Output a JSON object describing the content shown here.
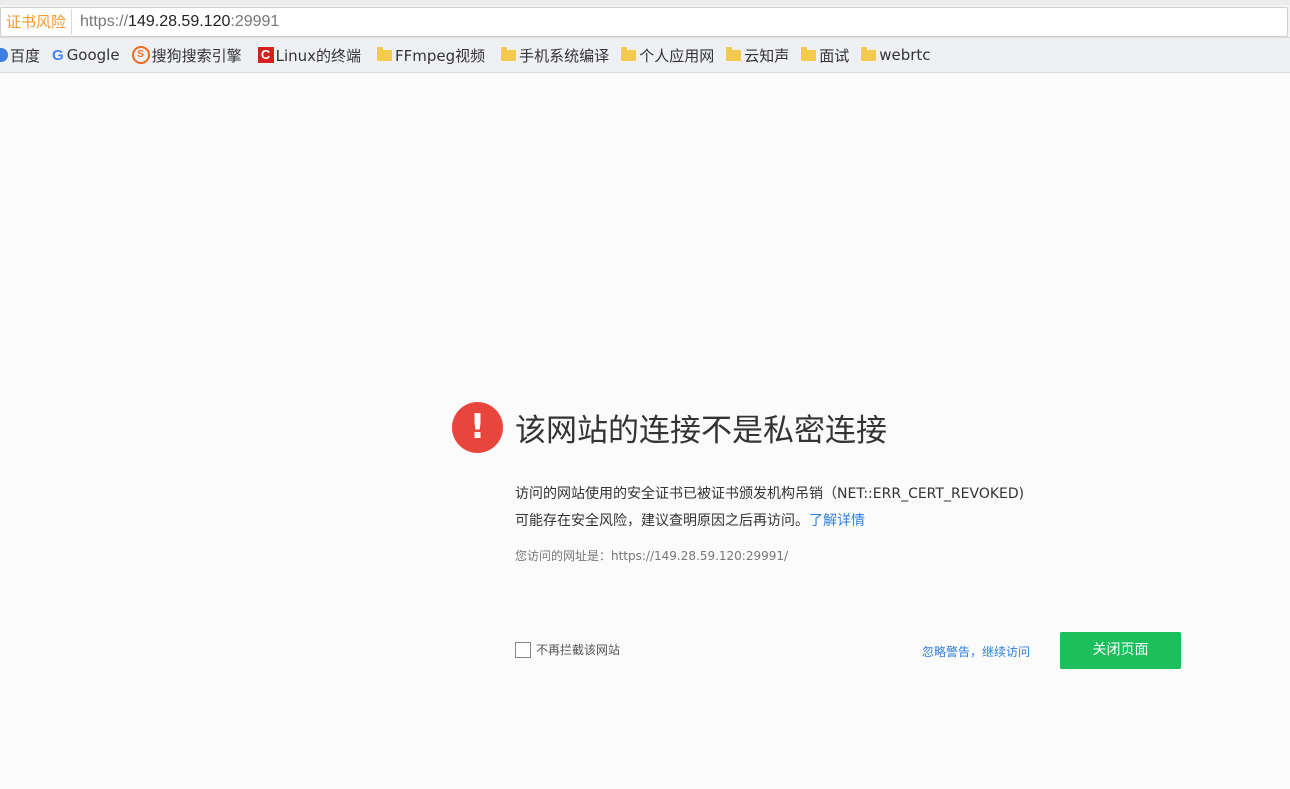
{
  "address_bar": {
    "risk_badge": "证书风险",
    "url_prefix": "https://",
    "url_host": "149.28.59.120",
    "url_port": ":29991"
  },
  "bookmarks": [
    {
      "label": "百度",
      "icon": "baidu-icon"
    },
    {
      "label": "Google",
      "icon": "google-icon"
    },
    {
      "label": "搜狗搜索引擎",
      "icon": "sogou-icon"
    },
    {
      "label": "Linux的终端",
      "icon": "csdn-icon"
    },
    {
      "label": "FFmpeg视频",
      "icon": "folder-icon"
    },
    {
      "label": "手机系统编译",
      "icon": "folder-icon"
    },
    {
      "label": "个人应用网",
      "icon": "folder-icon"
    },
    {
      "label": "云知声",
      "icon": "folder-icon"
    },
    {
      "label": "面试",
      "icon": "folder-icon"
    },
    {
      "label": "webrtc",
      "icon": "folder-icon"
    }
  ],
  "error_page": {
    "alert_symbol": "!",
    "title": "该网站的连接不是私密连接",
    "desc_line1": "访问的网站使用的安全证书已被证书颁发机构吊销（NET::ERR_CERT_REVOKED)",
    "desc_line2": "可能存在安全风险，建议查明原因之后再访问。",
    "learn_more": "了解详情",
    "visited_url": "您访问的网址是：https://149.28.59.120:29991/",
    "dont_block_label": "不再拦截该网站",
    "ignore_warning": "忽略警告，继续访问",
    "close_page": "关闭页面"
  },
  "colors": {
    "alert_red": "#e8453c",
    "link_blue": "#2e7fe0",
    "button_green": "#1bbf5c",
    "risk_orange": "#f29a2e"
  }
}
